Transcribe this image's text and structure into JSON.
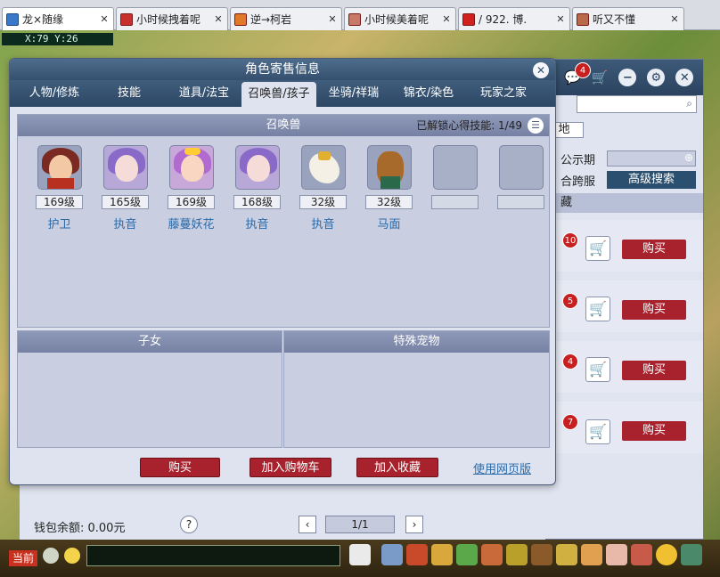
{
  "browser_tabs": [
    {
      "label": "龙×随缘",
      "active": true
    },
    {
      "label": "小时候拽着呢",
      "active": false
    },
    {
      "label": "逆→柯岩",
      "active": false
    },
    {
      "label": "小时候美着呢",
      "active": false
    },
    {
      "label": "/ 922. 博.",
      "active": false
    },
    {
      "label": "听又不懂",
      "active": false
    }
  ],
  "game": {
    "coords": "X:79 Y:26",
    "current_channel": "当前"
  },
  "dialog": {
    "title": "角色寄售信息",
    "tabs": [
      "人物/修炼",
      "技能",
      "道具/法宝",
      "召唤兽/孩子",
      "坐骑/祥瑞",
      "锦衣/染色",
      "玩家之家"
    ],
    "active_tab": "召唤兽/孩子",
    "summon_section": {
      "title": "召唤兽",
      "info": "已解锁心得技能: 1/49"
    },
    "pets": [
      {
        "level": "169级",
        "name": "护卫"
      },
      {
        "level": "165级",
        "name": "执音"
      },
      {
        "level": "169级",
        "name": "藤蔓妖花"
      },
      {
        "level": "168级",
        "name": "执音"
      },
      {
        "level": "32级",
        "name": "执音"
      },
      {
        "level": "32级",
        "name": "马面"
      },
      {
        "level": "",
        "name": ""
      },
      {
        "level": "",
        "name": ""
      }
    ],
    "children_section": "子女",
    "special_section": "特殊宠物",
    "buttons": {
      "buy": "购买",
      "add_cart": "加入购物车",
      "add_fav": "加入收藏"
    },
    "web_link": "使用网页版"
  },
  "right_panel": {
    "mail_badge": "4",
    "server_char": "地",
    "label_public": "公示期",
    "label_cross": "合跨服",
    "adv_search": "高级搜索",
    "cat_header": "藏",
    "items": [
      {
        "badge": "10",
        "buy": "购买"
      },
      {
        "badge": "5",
        "buy": "购买"
      },
      {
        "badge": "4",
        "buy": "购买"
      },
      {
        "badge": "7",
        "buy": "购买"
      }
    ]
  },
  "footer": {
    "wallet": "钱包余额: 0.00元",
    "page": "1/1",
    "help": "?"
  }
}
